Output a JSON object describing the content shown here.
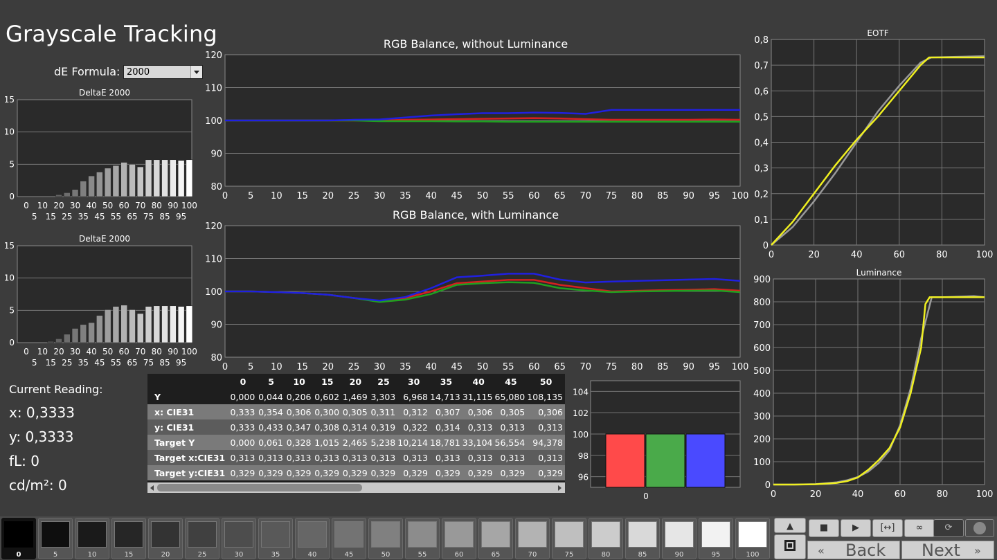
{
  "title": "Grayscale Tracking",
  "de_formula": {
    "label": "dE Formula:",
    "value": "2000"
  },
  "delta_chart_title": "DeltaE 2000",
  "delta_chart_title_2": "DeltaE 2000",
  "current_reading": {
    "title": "Current Reading:",
    "x": "x: 0,3333",
    "y": "y: 0,3333",
    "fl": "fL: 0",
    "cdm2": "cd/m²: 0"
  },
  "rgb_chart_title_1": "RGB Balance, without Luminance",
  "rgb_chart_title_2": "RGB Balance, with Luminance",
  "eotf_title": "EOTF",
  "luminance_title": "Luminance",
  "table": {
    "headers": [
      "0",
      "5",
      "10",
      "15",
      "20",
      "25",
      "30",
      "35",
      "40",
      "45",
      "50"
    ],
    "rows": [
      {
        "label": "Y",
        "values": [
          "0,000",
          "0,044",
          "0,206",
          "0,602",
          "1,469",
          "3,303",
          "6,968",
          "14,713",
          "31,115",
          "65,080",
          "108,135"
        ]
      },
      {
        "label": "x: CIE31",
        "values": [
          "0,333",
          "0,354",
          "0,306",
          "0,300",
          "0,305",
          "0,311",
          "0,312",
          "0,307",
          "0,306",
          "0,305",
          "0,306"
        ]
      },
      {
        "label": "y: CIE31",
        "values": [
          "0,333",
          "0,433",
          "0,347",
          "0,308",
          "0,314",
          "0,319",
          "0,322",
          "0,314",
          "0,313",
          "0,313",
          "0,313"
        ]
      },
      {
        "label": "Target Y",
        "values": [
          "0,000",
          "0,061",
          "0,328",
          "1,015",
          "2,465",
          "5,238",
          "10,214",
          "18,781",
          "33,104",
          "56,554",
          "94,378"
        ]
      },
      {
        "label": "Target x:CIE31",
        "values": [
          "0,313",
          "0,313",
          "0,313",
          "0,313",
          "0,313",
          "0,313",
          "0,313",
          "0,313",
          "0,313",
          "0,313",
          "0,313"
        ]
      },
      {
        "label": "Target y:CIE31",
        "values": [
          "0,329",
          "0,329",
          "0,329",
          "0,329",
          "0,329",
          "0,329",
          "0,329",
          "0,329",
          "0,329",
          "0,329",
          "0,329"
        ]
      }
    ]
  },
  "patches": [
    "0",
    "5",
    "10",
    "15",
    "20",
    "25",
    "30",
    "35",
    "40",
    "45",
    "50",
    "55",
    "60",
    "65",
    "70",
    "75",
    "80",
    "85",
    "90",
    "95",
    "100"
  ],
  "nav": {
    "back": "Back",
    "next": "Next"
  },
  "icons": [
    "up-arrow-icon",
    "stop-icon",
    "play-icon",
    "range-icon",
    "loop-icon",
    "refresh-icon",
    "circle-icon",
    "back-chevron-icon",
    "next-chevron-icon"
  ],
  "chart_data": [
    {
      "type": "bar",
      "id": "deltae-1",
      "title": "DeltaE 2000",
      "ylim": [
        0,
        15
      ],
      "yticks": [
        0,
        5,
        10,
        15
      ],
      "x": [
        0,
        5,
        10,
        15,
        20,
        25,
        30,
        35,
        40,
        45,
        50,
        55,
        60,
        65,
        70,
        75,
        80,
        85,
        90,
        95,
        100
      ],
      "values": [
        0,
        0,
        0,
        0,
        0.3,
        0.6,
        1.1,
        2.4,
        3.2,
        3.8,
        4.4,
        4.8,
        5.3,
        5.0,
        4.6,
        5.7,
        5.7,
        5.7,
        5.7,
        5.6,
        5.7
      ]
    },
    {
      "type": "bar",
      "id": "deltae-2",
      "title": "DeltaE 2000",
      "ylim": [
        0,
        15
      ],
      "yticks": [
        0,
        5,
        10,
        15
      ],
      "x": [
        0,
        5,
        10,
        15,
        20,
        25,
        30,
        35,
        40,
        45,
        50,
        55,
        60,
        65,
        70,
        75,
        80,
        85,
        90,
        95,
        100
      ],
      "values": [
        0,
        0,
        0,
        0.2,
        0.6,
        1.3,
        2.2,
        2.8,
        3.1,
        4.2,
        5.1,
        5.6,
        5.8,
        5.1,
        4.5,
        5.6,
        5.7,
        5.7,
        5.7,
        5.6,
        5.7
      ]
    },
    {
      "type": "line",
      "id": "rgb-no-lum",
      "title": "RGB Balance, without Luminance",
      "ylim": [
        80,
        120
      ],
      "yticks": [
        80,
        90,
        100,
        110,
        120
      ],
      "x": [
        0,
        5,
        10,
        15,
        20,
        25,
        30,
        35,
        40,
        45,
        50,
        55,
        60,
        65,
        70,
        75,
        80,
        85,
        90,
        95,
        100
      ],
      "series": [
        {
          "color": "#d42020",
          "values": [
            100,
            100,
            100,
            100,
            100,
            100,
            100,
            100.2,
            100.3,
            100.4,
            100.5,
            100.6,
            100.7,
            100.6,
            100.4,
            100.2,
            100.2,
            100.2,
            100.2,
            100.3,
            100.2
          ]
        },
        {
          "color": "#20a020",
          "values": [
            100,
            100,
            100,
            100,
            100,
            100,
            99.8,
            99.8,
            99.8,
            99.7,
            99.7,
            99.6,
            99.6,
            99.6,
            99.6,
            99.6,
            99.6,
            99.6,
            99.6,
            99.6,
            99.6
          ]
        },
        {
          "color": "#2020e0",
          "values": [
            100,
            100,
            100,
            100,
            100,
            100.2,
            100.3,
            100.9,
            101.5,
            101.9,
            102.2,
            102.2,
            102.4,
            102.3,
            102.0,
            103.2,
            103.2,
            103.2,
            103.2,
            103.2,
            103.2
          ]
        }
      ]
    },
    {
      "type": "line",
      "id": "rgb-lum",
      "title": "RGB Balance, with Luminance",
      "ylim": [
        80,
        120
      ],
      "yticks": [
        80,
        90,
        100,
        110,
        120
      ],
      "x": [
        0,
        5,
        10,
        15,
        20,
        25,
        30,
        35,
        40,
        45,
        50,
        55,
        60,
        65,
        70,
        75,
        80,
        85,
        90,
        95,
        100
      ],
      "series": [
        {
          "color": "#d42020",
          "values": [
            100,
            100,
            99.8,
            99.5,
            99,
            98,
            97,
            98,
            100,
            102.5,
            103,
            103.5,
            103.5,
            102,
            101,
            100,
            100.2,
            100.4,
            100.5,
            100.7,
            100.2
          ]
        },
        {
          "color": "#20a020",
          "values": [
            100,
            100,
            99.8,
            99.5,
            99,
            98,
            96.8,
            97.5,
            99.2,
            102,
            102.5,
            102.8,
            102.6,
            101,
            100.3,
            99.8,
            100,
            100.1,
            100.2,
            100.3,
            99.8
          ]
        },
        {
          "color": "#2020e0",
          "values": [
            100,
            100,
            99.8,
            99.5,
            99,
            98,
            97.2,
            98.3,
            101,
            104.3,
            104.8,
            105.4,
            105.4,
            103.6,
            102.7,
            103,
            103.2,
            103.4,
            103.6,
            103.8,
            103.2
          ]
        }
      ]
    },
    {
      "type": "line",
      "id": "eotf",
      "title": "EOTF",
      "xlim": [
        0,
        100
      ],
      "ylim": [
        0,
        0.8
      ],
      "xticks": [
        0,
        20,
        40,
        60,
        80,
        100
      ],
      "yticks": [
        "0",
        "0,1",
        "0,2",
        "0,3",
        "0,4",
        "0,5",
        "0,6",
        "0,7",
        "0,8"
      ],
      "series": [
        {
          "color": "#f0f020",
          "x": [
            0,
            10,
            20,
            30,
            40,
            50,
            60,
            70,
            74,
            75,
            100
          ],
          "values": [
            0,
            0.09,
            0.2,
            0.31,
            0.41,
            0.5,
            0.6,
            0.7,
            0.73,
            0.73,
            0.73
          ]
        },
        {
          "color": "#9a9a9a",
          "x": [
            0,
            10,
            20,
            30,
            40,
            50,
            60,
            70,
            75,
            100
          ],
          "values": [
            0,
            0.07,
            0.17,
            0.28,
            0.4,
            0.52,
            0.62,
            0.71,
            0.73,
            0.735
          ]
        }
      ]
    },
    {
      "type": "line",
      "id": "luminance",
      "title": "Luminance",
      "xlim": [
        0,
        100
      ],
      "ylim": [
        0,
        900
      ],
      "xticks": [
        0,
        20,
        40,
        60,
        80,
        100
      ],
      "yticks": [
        0,
        100,
        200,
        300,
        400,
        500,
        600,
        700,
        800,
        900
      ],
      "series": [
        {
          "color": "#f0f020",
          "x": [
            0,
            10,
            20,
            30,
            35,
            40,
            45,
            50,
            55,
            60,
            65,
            70,
            72,
            74,
            75,
            100
          ],
          "values": [
            0,
            0,
            1,
            7,
            15,
            31,
            65,
            108,
            160,
            250,
            400,
            600,
            790,
            820,
            820,
            820
          ]
        },
        {
          "color": "#9a9a9a",
          "x": [
            0,
            10,
            20,
            30,
            35,
            40,
            45,
            50,
            55,
            60,
            65,
            70,
            75,
            80,
            95,
            100
          ],
          "values": [
            0,
            0,
            2,
            10,
            19,
            33,
            57,
            95,
            150,
            260,
            420,
            640,
            820,
            820,
            825,
            820
          ]
        }
      ]
    },
    {
      "type": "bar",
      "id": "rgb-levels",
      "categories": [
        "0"
      ],
      "ylim": [
        95,
        105
      ],
      "yticks": [
        96,
        98,
        100,
        102,
        104
      ],
      "series": [
        {
          "color": "#ff4a4a",
          "values": [
            100
          ]
        },
        {
          "color": "#4aaa4a",
          "values": [
            100
          ]
        },
        {
          "color": "#4a4aff",
          "values": [
            100
          ]
        }
      ]
    }
  ]
}
